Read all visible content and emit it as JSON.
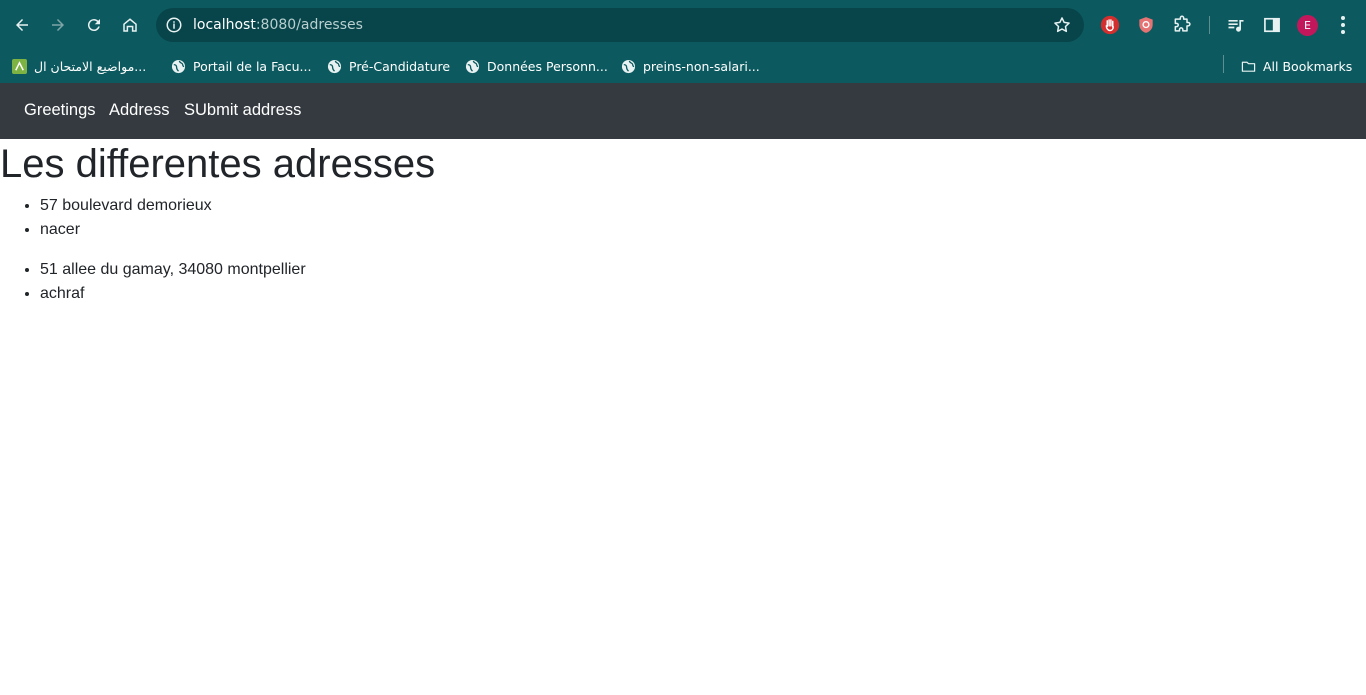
{
  "browser": {
    "url_host": "localhost",
    "url_rest": ":8080/adresses",
    "profile_initial": "E",
    "bookmarks": [
      {
        "label": "مواضيع الامتحان ال..."
      },
      {
        "label": "Portail de la Facu..."
      },
      {
        "label": "Pré-Candidature"
      },
      {
        "label": "Données Personn..."
      },
      {
        "label": "preins-non-salari..."
      }
    ],
    "all_bookmarks": "All Bookmarks"
  },
  "navbar": {
    "links": [
      {
        "label": "Greetings"
      },
      {
        "label": "Address"
      },
      {
        "label": "SUbmit address"
      }
    ]
  },
  "main": {
    "title": "Les differentes adresses",
    "addresses": [
      {
        "address": "57 boulevard demorieux",
        "name": "nacer"
      },
      {
        "address": "51 allee du gamay, 34080 montpellier",
        "name": "achraf"
      }
    ]
  },
  "colors": {
    "chrome": "#0c5a5f",
    "omnibox": "#07454a",
    "navbar": "#343a40",
    "text": "#212529",
    "avatar": "#c2185b"
  }
}
